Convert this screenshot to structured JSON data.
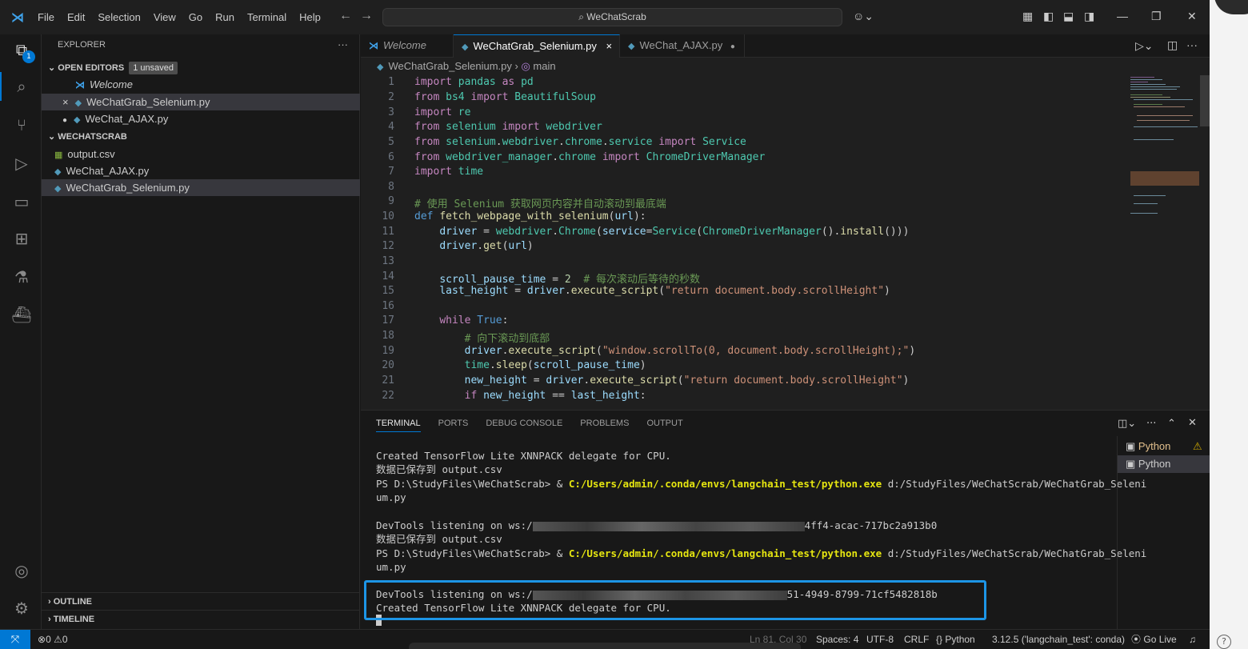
{
  "titlebar": {
    "menu": [
      "File",
      "Edit",
      "Selection",
      "View",
      "Go",
      "Run",
      "Terminal",
      "Help"
    ],
    "search_text": "WeChatScrab"
  },
  "activity": {
    "badge": "1"
  },
  "explorer": {
    "header": "EXPLORER",
    "more": "···",
    "open_editors_label": "OPEN EDITORS",
    "unsaved_badge": "1 unsaved",
    "open_editors": [
      {
        "name": "Welcome",
        "marker": ""
      },
      {
        "name": "WeChatGrab_Selenium.py",
        "marker": "×"
      },
      {
        "name": "WeChat_AJAX.py",
        "marker": "●"
      }
    ],
    "folder_label": "WECHATSCRAB",
    "files": [
      "output.csv",
      "WeChat_AJAX.py",
      "WeChatGrab_Selenium.py"
    ],
    "outline_label": "OUTLINE",
    "timeline_label": "TIMELINE"
  },
  "tabs": [
    {
      "label": "Welcome"
    },
    {
      "label": "WeChatGrab_Selenium.py",
      "close": "×"
    },
    {
      "label": "WeChat_AJAX.py",
      "dirty": "●"
    }
  ],
  "breadcrumb": {
    "file": "WeChatGrab_Selenium.py",
    "symbol": "main"
  },
  "editor_lines": [
    "1",
    "2",
    "3",
    "4",
    "5",
    "6",
    "7",
    "8",
    "9",
    "10",
    "11",
    "12",
    "13",
    "14",
    "15",
    "16",
    "17",
    "18",
    "19",
    "20",
    "21",
    "22"
  ],
  "panel": {
    "tabs": [
      "TERMINAL",
      "PORTS",
      "DEBUG CONSOLE",
      "PROBLEMS",
      "OUTPUT"
    ],
    "terminal": {
      "l1": "Created TensorFlow Lite XNNPACK delegate for CPU.",
      "l2": "数据已保存到 output.csv",
      "ps1": "PS D:\\StudyFiles\\WeChatScrab> & ",
      "exe": "C:/Users/admin/.conda/envs/langchain_test/python.exe",
      "arg1": " d:/StudyFiles/WeChatScrab/WeChatGrab_Seleni",
      "arg2": "um.py",
      "dev1a": "DevTools listening on ws:/",
      "dev1b": "4ff4-acac-717bc2a913b0",
      "dev2b": "51-4949-8799-71cf5482818b"
    },
    "terminals": [
      "Python",
      "Python"
    ]
  },
  "statusbar": {
    "errors": "0",
    "warnings": "0",
    "position": "Ln 81, Col 30",
    "spaces": "Spaces: 4",
    "encoding": "UTF-8",
    "eol": "CRLF",
    "language": "Python",
    "interpreter": "3.12.5 ('langchain_test': conda)",
    "golive": "Go Live"
  },
  "colors": {
    "accent": "#0078d4",
    "highlight": "#1d95e6"
  }
}
